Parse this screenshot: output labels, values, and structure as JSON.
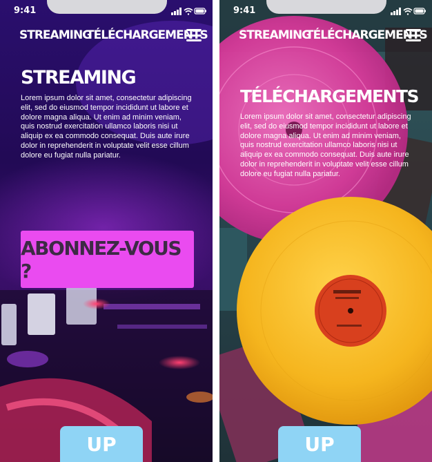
{
  "screens": [
    {
      "time": "9:41",
      "nav": {
        "streaming": "STREAMING",
        "downloads": "TÉLÉCHARGEMENTS"
      },
      "heading": "STREAMING",
      "body": "Lorem ipsum dolor sit amet, consectetur adipiscing elit, sed do eiusmod tempor incididunt ut labore et dolore magna aliqua. Ut enim ad minim veniam, quis nostrud exercitation ullamco laboris nisi ut aliquip ex ea commodo consequat. Duis aute irure dolor in reprehenderit in voluptate velit esse cillum dolore eu fugiat nulla pariatur.",
      "cta": "ABONNEZ-VOUS ?",
      "up": "UP"
    },
    {
      "time": "9:41",
      "nav": {
        "streaming": "STREAMING",
        "downloads": "TÉLÉCHARGEMENTS"
      },
      "heading": "TÉLÉCHARGEMENTS",
      "body": "Lorem ipsum dolor sit amet, consectetur adipiscing elit, sed do eiusmod tempor incididunt ut labore et dolore magna aliqua. Ut enim ad minim veniam, quis nostrud exercitation ullamco laboris nisi ut aliquip ex ea commodo consequat. Duis aute irure dolor in reprehenderit in voluptate velit esse cillum dolore eu fugiat nulla pariatur.",
      "up": "UP"
    }
  ],
  "icons": [
    "signal-icon",
    "wifi-icon",
    "battery-icon",
    "menu-icon"
  ],
  "colors": {
    "cta": "#ea4bf0",
    "up_button": "#8fd4f5",
    "record_yellow": "#f4b41a",
    "record_pink": "#e0459e"
  }
}
